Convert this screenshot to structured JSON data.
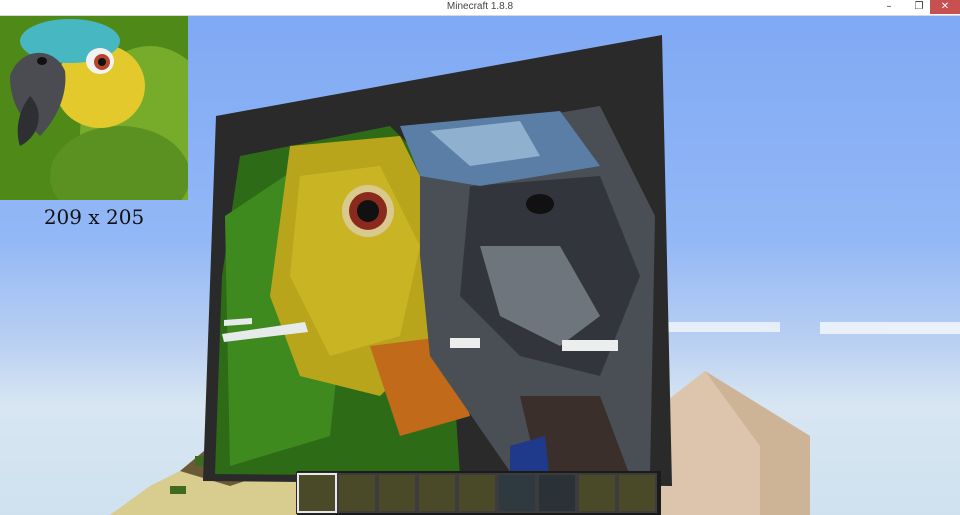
{
  "window": {
    "title": "Minecraft 1.8.8",
    "controls": [
      "minimize",
      "maximize",
      "close"
    ]
  },
  "reference_image": {
    "icon": "parrot-photo",
    "size_label": "209 x 205"
  },
  "hotbar": {
    "slot_count": 9,
    "selected_slot": 1
  },
  "colors": {
    "sky_top": "#7fa9f4",
    "sky_bottom": "#d8e6f2",
    "close_button": "#c75050"
  }
}
